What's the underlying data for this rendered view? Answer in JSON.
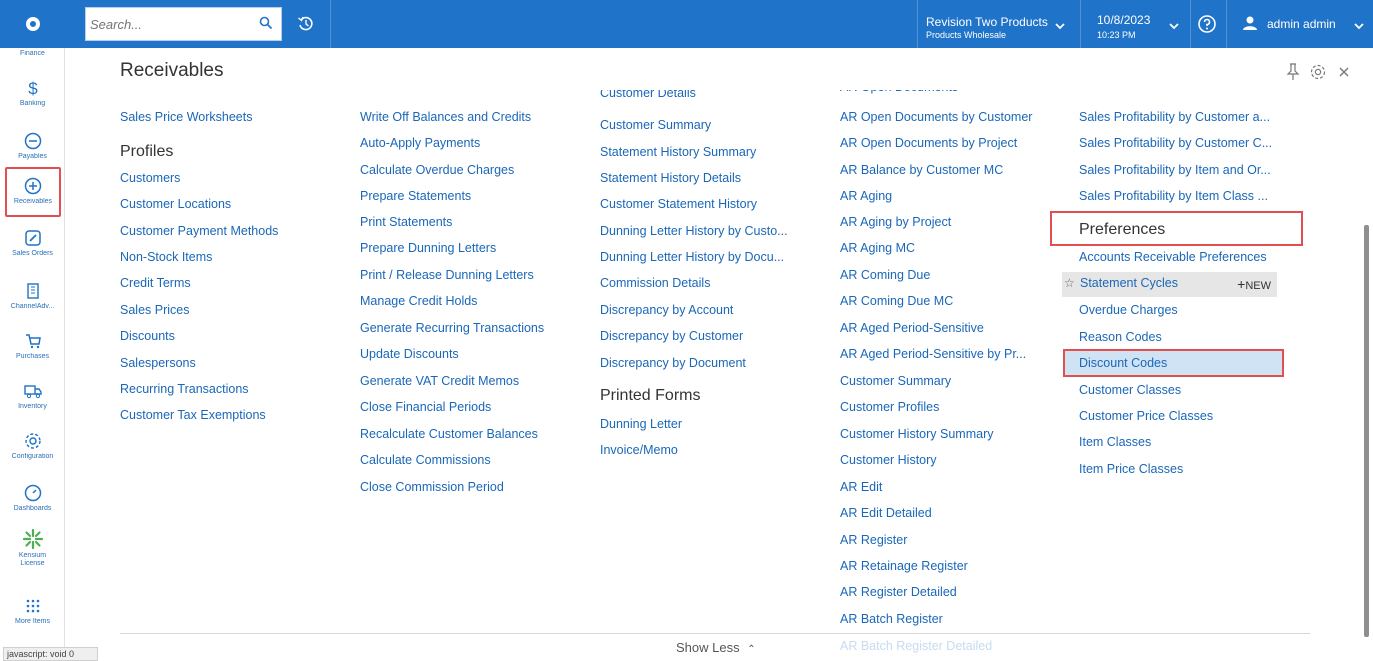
{
  "search": {
    "placeholder": "Search..."
  },
  "company": {
    "name": "Revision Two Products",
    "branch": "Products Wholesale"
  },
  "datetime": {
    "date": "10/8/2023",
    "time": "10:23 PM"
  },
  "user": {
    "name": "admin admin"
  },
  "sidebar": {
    "items": [
      {
        "label": "Finance"
      },
      {
        "label": "Banking"
      },
      {
        "label": "Payables"
      },
      {
        "label": "Receivables"
      },
      {
        "label": "Sales Orders"
      },
      {
        "label": "ChannelAdv..."
      },
      {
        "label": "Purchases"
      },
      {
        "label": "Inventory"
      },
      {
        "label": "Configuration"
      },
      {
        "label": "Dashboards"
      },
      {
        "label": "Kensium License"
      },
      {
        "label": "More Items"
      }
    ]
  },
  "page": {
    "title": "Receivables"
  },
  "col1": {
    "top": "Sales Price Worksheets",
    "heading": "Profiles",
    "items": [
      "Customers",
      "Customer Locations",
      "Customer Payment Methods",
      "Non-Stock Items",
      "Credit Terms",
      "Sales Prices",
      "Discounts",
      "Salespersons",
      "Recurring Transactions",
      "Customer Tax Exemptions"
    ]
  },
  "col2": {
    "items": [
      "Write Off Balances and Credits",
      "Auto-Apply Payments",
      "Calculate Overdue Charges",
      "Prepare Statements",
      "Print Statements",
      "Prepare Dunning Letters",
      "Print / Release Dunning Letters",
      "Manage Credit Holds",
      "Generate Recurring Transactions",
      "Update Discounts",
      "Generate VAT Credit Memos",
      "Close Financial Periods",
      "Recalculate Customer Balances",
      "Calculate Commissions",
      "Close Commission Period"
    ]
  },
  "col3": {
    "cut_top": "Customer Details",
    "items": [
      "Customer Summary",
      "Statement History Summary",
      "Statement History Details",
      "Customer Statement History",
      "Dunning Letter History by Custo...",
      "Dunning Letter History by Docu...",
      "Commission Details",
      "Discrepancy by Account",
      "Discrepancy by Customer",
      "Discrepancy by Document"
    ],
    "heading": "Printed Forms",
    "forms": [
      "Dunning Letter",
      "Invoice/Memo"
    ]
  },
  "col4": {
    "items": [
      "AR Open Documents by Customer",
      "AR Open Documents by Project",
      "AR Balance by Customer MC",
      "AR Aging",
      "AR Aging by Project",
      "AR Aging MC",
      "AR Coming Due",
      "AR Coming Due MC",
      "AR Aged Period-Sensitive",
      "AR Aged Period-Sensitive by Pr...",
      "Customer Summary",
      "Customer Profiles",
      "Customer History Summary",
      "Customer History",
      "AR Edit",
      "AR Edit Detailed",
      "AR Register",
      "AR Retainage Register",
      "AR Register Detailed",
      "AR Batch Register"
    ],
    "faded": "AR Batch Register Detailed"
  },
  "col5": {
    "items": [
      "Sales Profitability by Customer a...",
      "Sales Profitability by Customer C...",
      "Sales Profitability by Item and Or...",
      "Sales Profitability by Item Class ..."
    ],
    "heading": "Preferences",
    "prefs": [
      "Accounts Receivable Preferences",
      "Statement Cycles",
      "Overdue Charges",
      "Reason Codes",
      "Discount Codes",
      "Customer Classes",
      "Customer Price Classes",
      "Item Classes",
      "Item Price Classes"
    ],
    "new_label": "NEW"
  },
  "footer": {
    "show_less": "Show Less",
    "status": "javascript: void 0"
  },
  "colors": {
    "topbar": "#1f73c8",
    "link": "#1a67b8",
    "highlight": "#e05050",
    "selected": "#cfe3f4"
  }
}
